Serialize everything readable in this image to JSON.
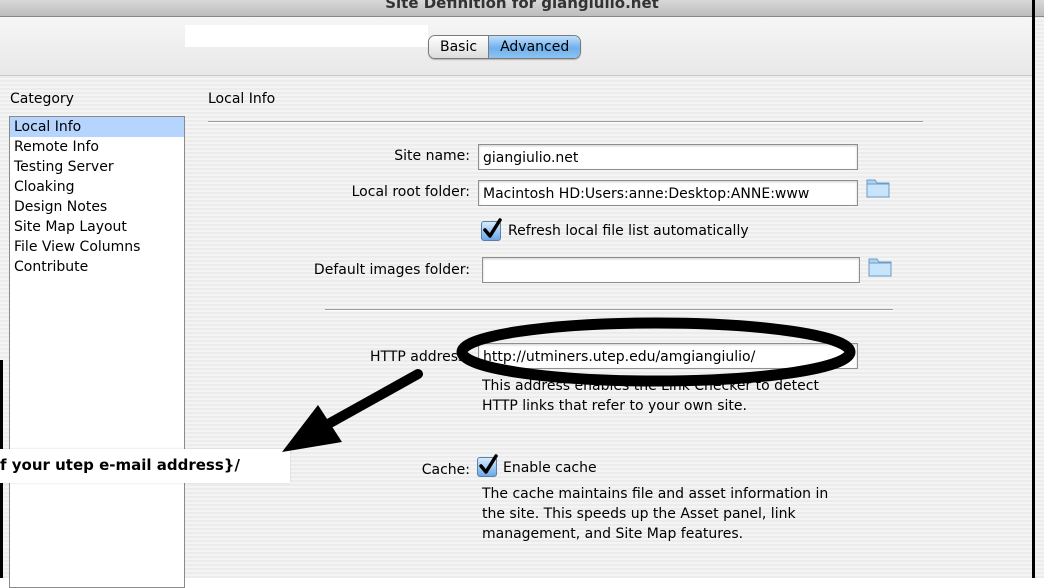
{
  "window": {
    "title": "Site Definition for giangiulio.net"
  },
  "tabs": {
    "basic": "Basic",
    "advanced": "Advanced"
  },
  "category": {
    "label": "Category",
    "items": [
      "Local Info",
      "Remote Info",
      "Testing Server",
      "Cloaking",
      "Design Notes",
      "Site Map Layout",
      "File View Columns",
      "Contribute"
    ]
  },
  "local_info": {
    "title": "Local Info",
    "site_name_label": "Site name:",
    "site_name_value": "giangiulio.net",
    "local_root_label": "Local root folder:",
    "local_root_value": "Macintosh HD:Users:anne:Desktop:ANNE:www",
    "refresh_label": "Refresh local file list automatically",
    "default_images_label": "Default images folder:",
    "default_images_value": "",
    "http_label": "HTTP address:",
    "http_value": "http://utminers.utep.edu/amgiangiulio/",
    "http_help_1": "This address enables the Link Checker to detect",
    "http_help_2": "HTTP links that refer to your own site.",
    "cache_label": "Cache:",
    "cache_checkbox_label": "Enable cache",
    "cache_help_1": "The cache maintains file and asset information in",
    "cache_help_2": "the site.  This speeds up the Asset panel, link",
    "cache_help_3": "management, and Site Map features."
  },
  "annotation": {
    "callout_text": "f your utep e-mail address}/"
  },
  "colors": {
    "selected_row": "#b5d5ff",
    "tab_active": "#6fb0ec",
    "checkbox": "#6aa8e6",
    "folder": "#a9d3f5"
  },
  "icons": {
    "folder": "folder-icon",
    "check": "checkmark-icon"
  }
}
